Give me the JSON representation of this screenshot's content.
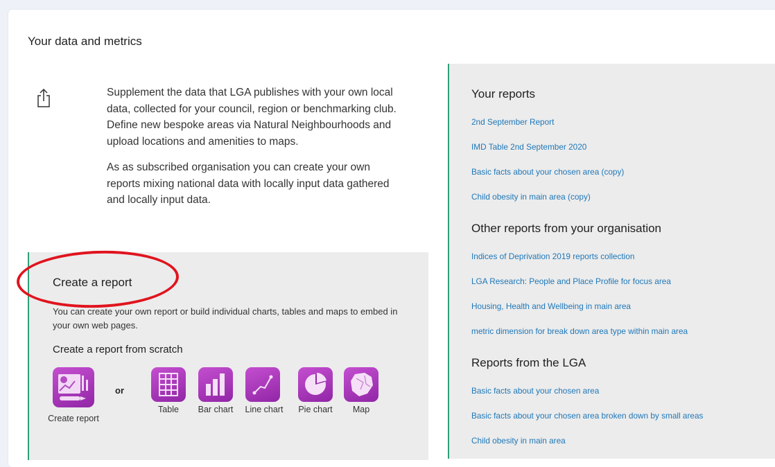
{
  "section_title": "Your data and metrics",
  "intro": {
    "paragraph1": "Supplement the data that LGA publishes with your own local data, collected for your council, region or benchmarking club. Define new bespoke areas via Natural Neighbourhoods and upload locations and amenities to maps.",
    "paragraph2": "As as subscribed organisation you can create your own reports mixing national data with locally input data gathered and locally input data."
  },
  "create": {
    "title": "Create a report",
    "description": "You can create your own report or build individual charts, tables and maps to embed in your own web pages.",
    "scratch_title": "Create a report from scratch",
    "or_label": "or",
    "create_report_label": "Create report",
    "tools": [
      {
        "label": "Table",
        "icon": "table-icon"
      },
      {
        "label": "Bar chart",
        "icon": "bar-chart-icon"
      },
      {
        "label": "Line chart",
        "icon": "line-chart-icon"
      },
      {
        "label": "Pie chart",
        "icon": "pie-chart-icon"
      },
      {
        "label": "Map",
        "icon": "map-icon"
      }
    ]
  },
  "your_reports": {
    "heading": "Your reports",
    "items": [
      "2nd September Report",
      "IMD Table 2nd September 2020",
      "Basic facts about your chosen area (copy)",
      "Child obesity in main area (copy)"
    ]
  },
  "org_reports": {
    "heading": "Other reports from your organisation",
    "items": [
      "Indices of Deprivation 2019 reports collection",
      "LGA Research: People and Place Profile for focus area",
      "Housing, Health and Wellbeing in main area",
      "metric dimension for break down area type within main area"
    ]
  },
  "lga_reports": {
    "heading": "Reports from the LGA",
    "items": [
      "Basic facts about your chosen area",
      "Basic facts about your chosen area broken down by small areas",
      "Child obesity in main area"
    ]
  },
  "colors": {
    "accent_green": "#2e9e7a",
    "link_blue": "#1e77b8",
    "tile_purple": "#9126a6",
    "annotation_red": "#e0141e"
  }
}
